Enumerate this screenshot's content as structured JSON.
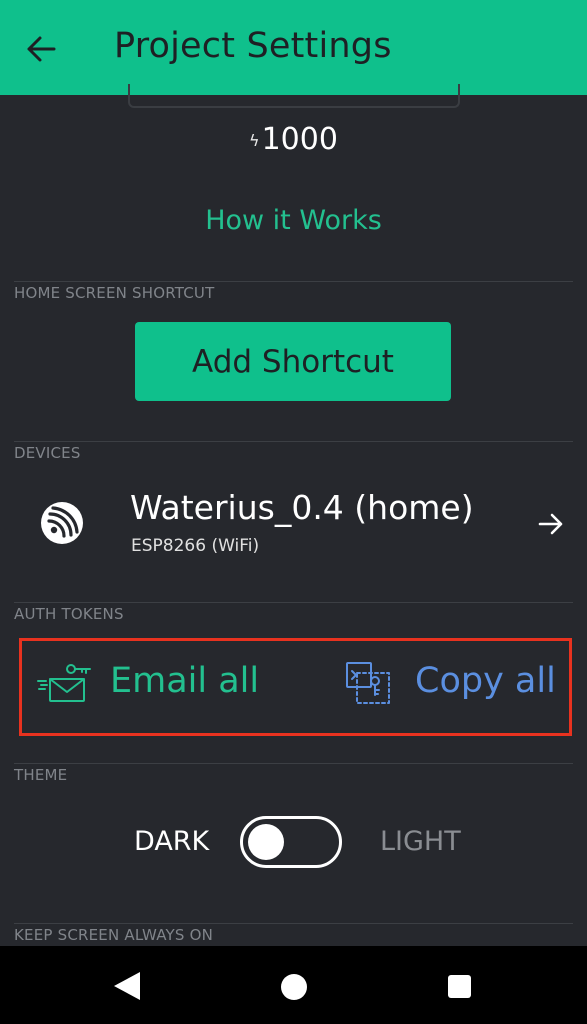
{
  "header": {
    "title": "Project Settings"
  },
  "energy": {
    "bolt_glyph": "ϟ",
    "value": "1000"
  },
  "how_it_works": "How it Works",
  "sections": {
    "home_shortcut": "HOME SCREEN SHORTCUT",
    "devices": "DEVICES",
    "auth_tokens": "AUTH TOKENS",
    "theme": "THEME",
    "keep_screen_on": "KEEP SCREEN ALWAYS ON"
  },
  "shortcut": {
    "button_label": "Add Shortcut"
  },
  "device": {
    "name": "Waterius_0.4 (home)",
    "subtitle": "ESP8266 (WiFi)"
  },
  "auth": {
    "email_label": "Email all",
    "copy_label": "Copy all"
  },
  "theme": {
    "dark_label": "DARK",
    "light_label": "LIGHT",
    "selected": "dark"
  },
  "colors": {
    "accent": "#0fc08c",
    "background": "#26282d",
    "link_green": "#23c08f",
    "copy_blue": "#5b8fe0",
    "highlight_red": "#e8321f"
  },
  "icons": {
    "back": "arrow-left-icon",
    "device": "espressif-logo-icon",
    "device_open": "arrow-right-icon",
    "email": "email-key-icon",
    "copy": "copy-key-icon",
    "nav_back": "triangle-back-icon",
    "nav_home": "circle-home-icon",
    "nav_recent": "square-recent-icon"
  }
}
